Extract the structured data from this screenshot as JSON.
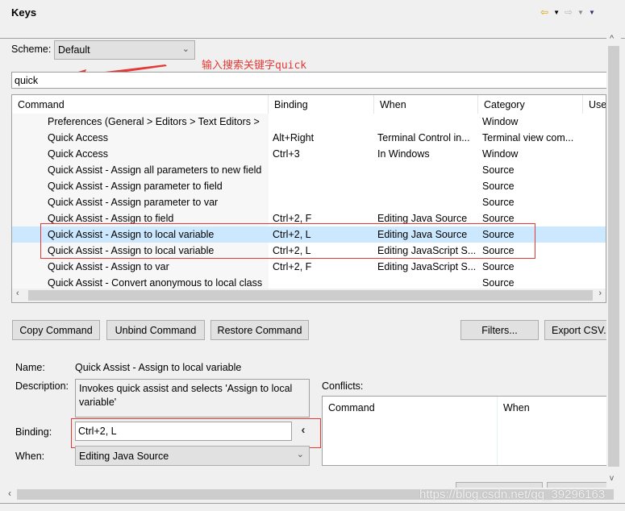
{
  "title": "Keys",
  "nav_icons": [
    "back-arrow-icon",
    "back-dropdown-icon",
    "forward-arrow-icon",
    "forward-dropdown-icon",
    "view-menu-icon"
  ],
  "scheme": {
    "label": "Scheme:",
    "value": "Default"
  },
  "annotation": "输入搜索关键字quick",
  "search": {
    "value": "quick"
  },
  "table": {
    "columns": [
      "Command",
      "Binding",
      "When",
      "Category",
      "Use"
    ],
    "rows": [
      {
        "command": "Preferences (General > Editors > Text Editors >",
        "binding": "",
        "when": "",
        "category": "Window"
      },
      {
        "command": "Quick Access",
        "binding": "Alt+Right",
        "when": "Terminal Control in...",
        "category": "Terminal view com..."
      },
      {
        "command": "Quick Access",
        "binding": "Ctrl+3",
        "when": "In Windows",
        "category": "Window"
      },
      {
        "command": "Quick Assist - Assign all parameters to new field",
        "binding": "",
        "when": "",
        "category": "Source"
      },
      {
        "command": "Quick Assist - Assign parameter to field",
        "binding": "",
        "when": "",
        "category": "Source"
      },
      {
        "command": "Quick Assist - Assign parameter to var",
        "binding": "",
        "when": "",
        "category": "Source"
      },
      {
        "command": "Quick Assist - Assign to field",
        "binding": "Ctrl+2, F",
        "when": "Editing Java Source",
        "category": "Source"
      },
      {
        "command": "Quick Assist - Assign to local variable",
        "binding": "Ctrl+2, L",
        "when": "Editing Java Source",
        "category": "Source",
        "selected": true
      },
      {
        "command": "Quick Assist - Assign to local variable",
        "binding": "Ctrl+2, L",
        "when": "Editing JavaScript S...",
        "category": "Source"
      },
      {
        "command": "Quick Assist - Assign to var",
        "binding": "Ctrl+2, F",
        "when": "Editing JavaScript S...",
        "category": "Source"
      },
      {
        "command": "Quick Assist - Convert anonymous to local class",
        "binding": "",
        "when": "",
        "category": "Source"
      }
    ]
  },
  "buttons": {
    "copy": "Copy Command",
    "unbind": "Unbind Command",
    "restore": "Restore Command",
    "filters": "Filters...",
    "export": "Export CSV..."
  },
  "details": {
    "name_label": "Name:",
    "name_value": "Quick Assist - Assign to local variable",
    "description_label": "Description:",
    "description_value": "Invokes quick assist and selects 'Assign to local variable'",
    "binding_label": "Binding:",
    "binding_value": "Ctrl+2, L",
    "binding_button": "‹",
    "when_label": "When:",
    "when_value": "Editing Java Source",
    "conflicts_label": "Conflicts:",
    "conflicts_columns": [
      "Command",
      "When"
    ]
  },
  "watermark": "https://blog.csdn.net/qq_39296163",
  "colors": {
    "selection": "#cce8ff",
    "annotation": "#e53935"
  }
}
